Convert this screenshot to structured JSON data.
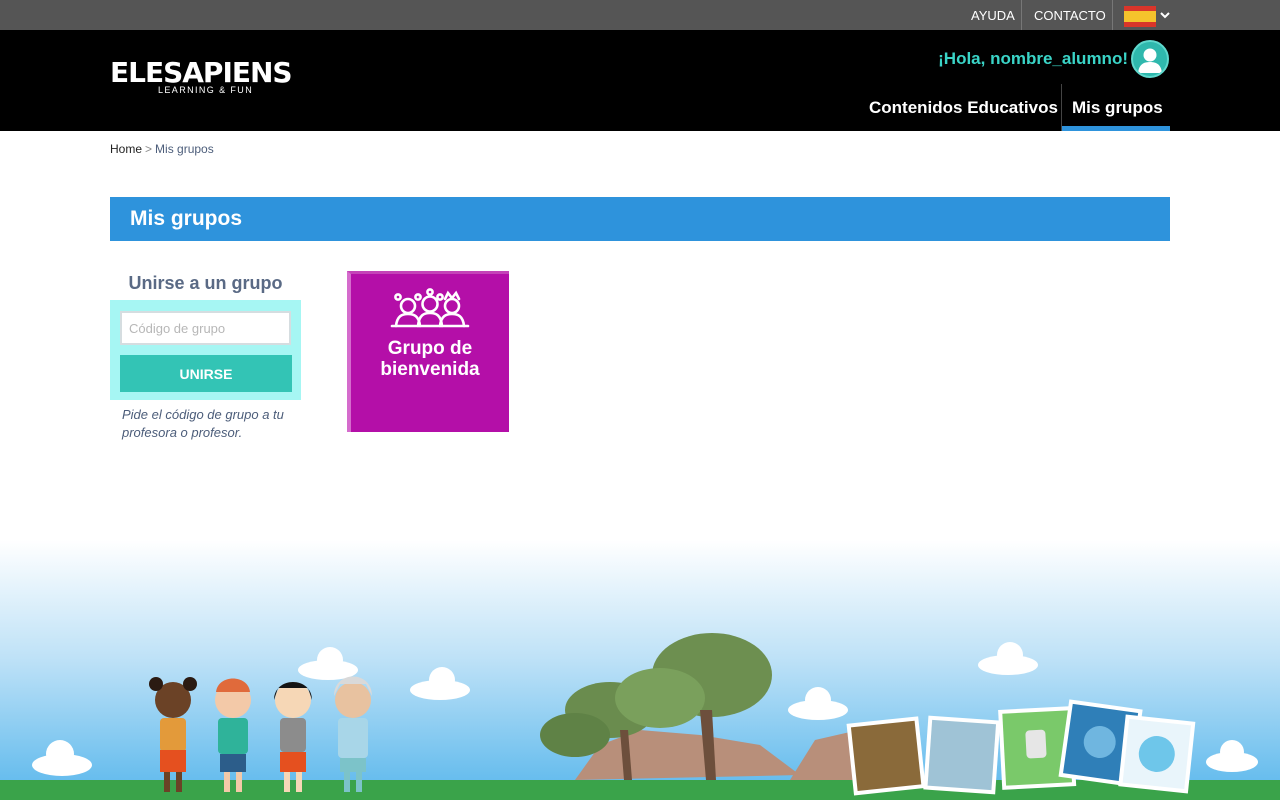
{
  "topbar": {
    "help_label": "AYUDA",
    "contact_label": "CONTACTO",
    "language_icon": "spain-flag-icon",
    "colors": {
      "bar": "#555555"
    }
  },
  "header": {
    "logo_main": "ELESAPIENS",
    "logo_sub": "LEARNING & FUN",
    "greeting": "¡Hola, nombre_alumno!",
    "nav": {
      "educational_content": "Contenidos Educativos",
      "my_groups": "Mis grupos"
    },
    "colors": {
      "background": "#000000",
      "greeting": "#3ad4c7",
      "active_tab": "#2e93dc"
    }
  },
  "breadcrumb": {
    "home": "Home",
    "separator": ">",
    "current": "Mis grupos"
  },
  "section": {
    "title": "Mis grupos",
    "color": "#2e93dc"
  },
  "join": {
    "title": "Unirse a un grupo",
    "input_placeholder": "Código de grupo",
    "input_value": "",
    "button_label": "UNIRSE",
    "hint": "Pide el código de grupo a tu profesora o profesor.",
    "colors": {
      "box": "#a6f6f3",
      "button": "#33c4b5"
    }
  },
  "groups": [
    {
      "name": "Grupo de bienvenida",
      "icon": "group-people-icon",
      "color": "#b40fa8"
    }
  ]
}
